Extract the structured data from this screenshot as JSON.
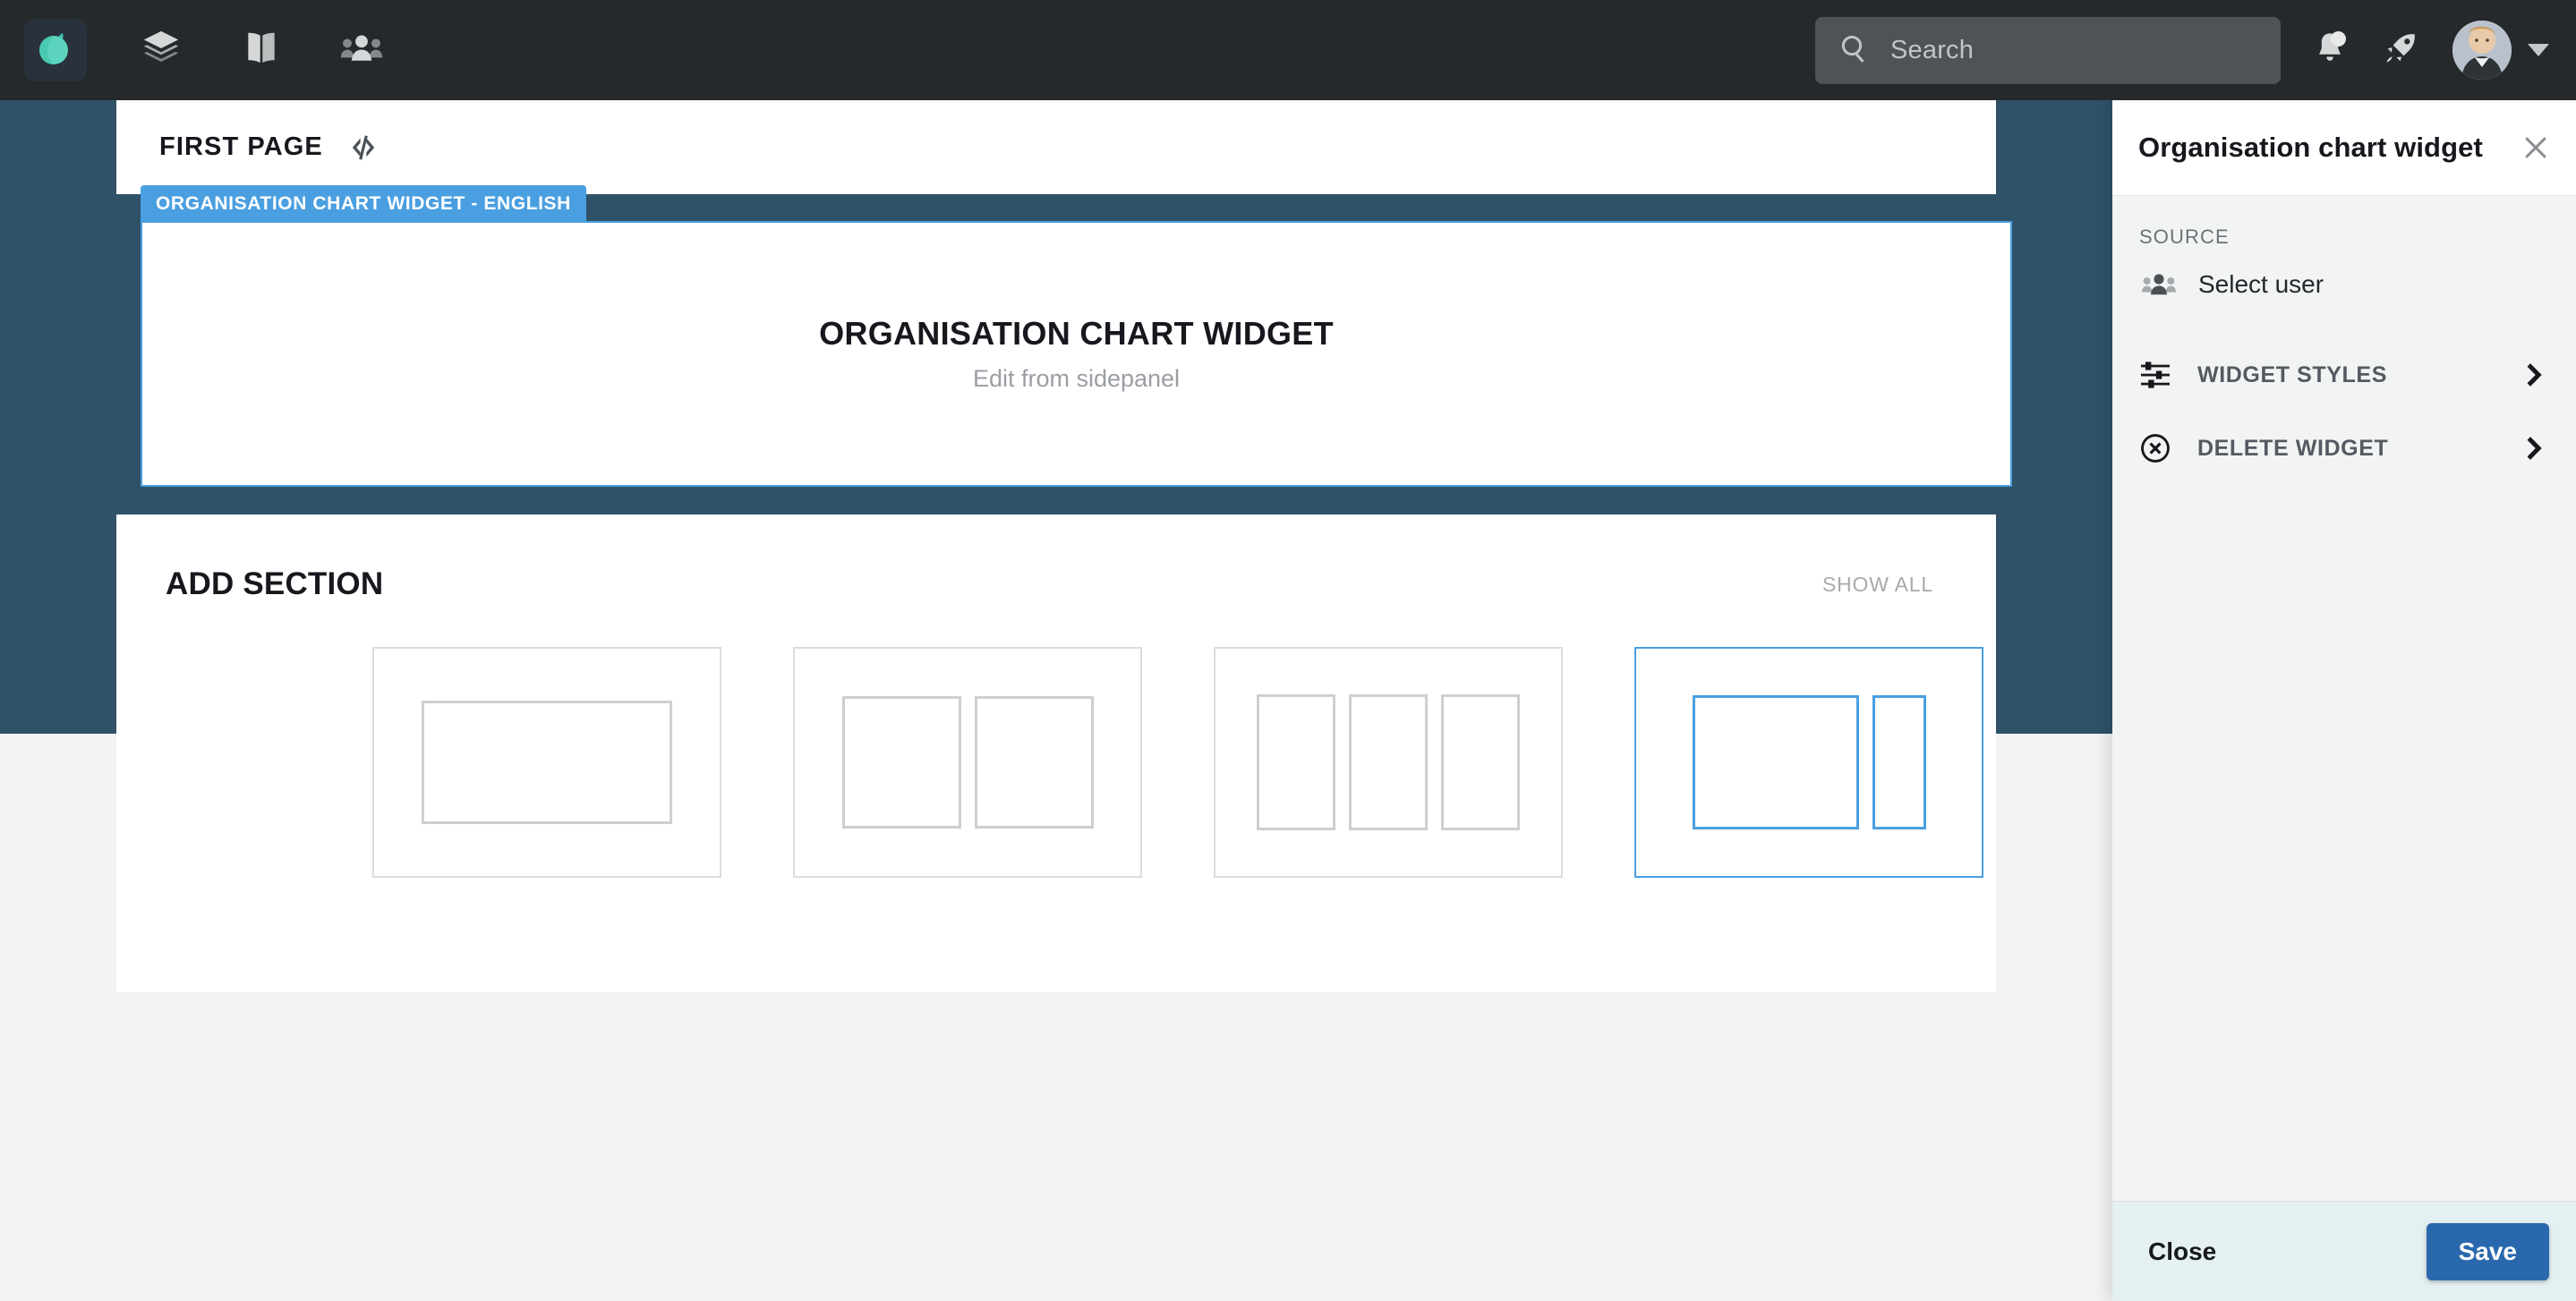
{
  "navbar": {
    "logo_icon": "leaf-logo-icon",
    "items": [
      {
        "icon": "layers-icon",
        "name": "nav-layers"
      },
      {
        "icon": "book-icon",
        "name": "nav-book"
      },
      {
        "icon": "people-icon",
        "name": "nav-people"
      }
    ],
    "search": {
      "placeholder": "Search",
      "value": "",
      "icon": "search-icon"
    },
    "notifications_icon": "bell-icon",
    "launch_icon": "rocket-icon",
    "avatar_alt": "user-avatar",
    "dropdown_icon": "caret-down-icon"
  },
  "page": {
    "title": "FIRST PAGE",
    "code_icon": "code-icon"
  },
  "widget": {
    "badge": "ORGANISATION CHART WIDGET - ENGLISH",
    "heading": "ORGANISATION CHART WIDGET",
    "subtext": "Edit from sidepanel"
  },
  "add_section": {
    "title": "ADD SECTION",
    "show_all": "SHOW ALL",
    "templates": [
      {
        "name": "layout-one-column",
        "selected": false
      },
      {
        "name": "layout-two-columns",
        "selected": false
      },
      {
        "name": "layout-three-columns",
        "selected": false
      },
      {
        "name": "layout-wide-narrow",
        "selected": true
      }
    ]
  },
  "sidepanel": {
    "title": "Organisation chart widget",
    "close_icon": "close-icon",
    "source_label": "SOURCE",
    "source_item": {
      "label": "Select user",
      "icon": "people-icon"
    },
    "menu": [
      {
        "label": "WIDGET STYLES",
        "icon": "sliders-icon",
        "chevron": "chevron-right-icon"
      },
      {
        "label": "DELETE WIDGET",
        "icon": "circle-x-icon",
        "chevron": "chevron-right-icon"
      }
    ],
    "footer": {
      "close_label": "Close",
      "save_label": "Save"
    }
  },
  "colors": {
    "navbar_bg": "#25292b",
    "canvas_bg": "#2f5268",
    "accent_blue": "#4a9fe0",
    "save_blue": "#2a68ad",
    "page_bg": "#f2f4f4",
    "logo_green": "#5bd3bd"
  }
}
